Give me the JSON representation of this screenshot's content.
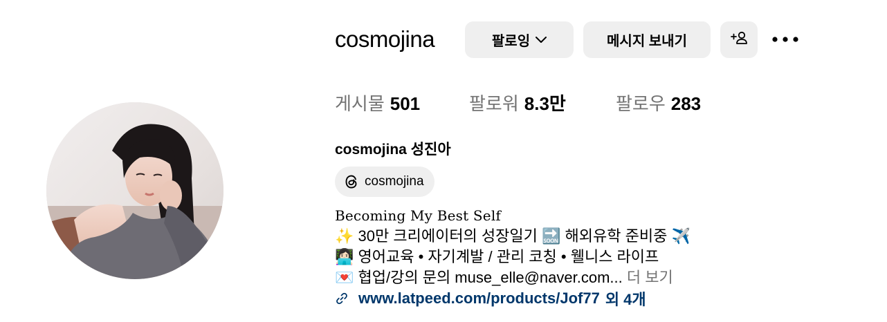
{
  "profile": {
    "username": "cosmojina",
    "full_name": "cosmojina 성진아"
  },
  "actions": {
    "follow_label": "팔로잉",
    "message_label": "메시지 보내기",
    "add_user_icon": "add-user-icon",
    "more_icon": "more-options-icon"
  },
  "stats": {
    "posts_label": "게시물",
    "posts_value": "501",
    "followers_label": "팔로워",
    "followers_value": "8.3만",
    "following_label": "팔로우",
    "following_value": "283"
  },
  "threads": {
    "handle": "cosmojina",
    "icon": "threads-icon"
  },
  "bio": {
    "headline": "Becoming My Best Self",
    "line1_emoji": "✨",
    "line1_text": "30만 크리에이터의 성장일기",
    "line1_emoji2": "🔜",
    "line1_text2": "해외유학 준비중",
    "line1_emoji3": "✈️",
    "line2_emoji": "👩🏻‍💻",
    "line2_text": "영어교육 • 자기계발 / 관리 코칭 • 웰니스 라이프",
    "line3_emoji": "💌",
    "line3_text": "협업/강의 문의 muse_elle@naver.com...",
    "more_label": "더 보기"
  },
  "link": {
    "url": "www.latpeed.com/products/Jof77",
    "extra": "외 4개",
    "icon": "link-icon"
  },
  "colors": {
    "button_bg": "#efefef",
    "secondary_text": "#737373",
    "link": "#00376b"
  }
}
